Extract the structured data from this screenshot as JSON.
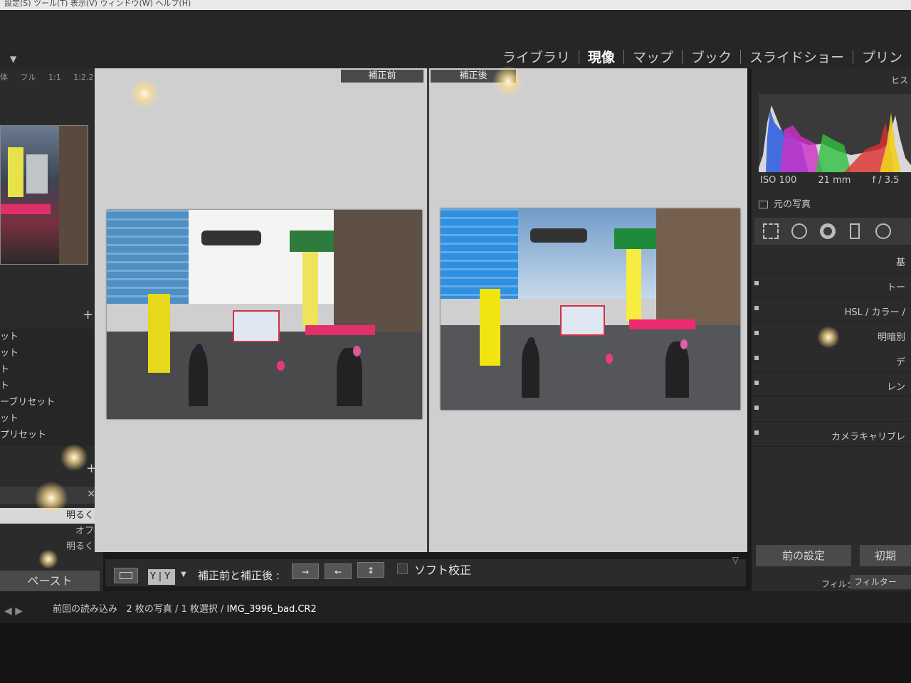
{
  "menubar": {
    "text": "設定(S)  ツール(T)  表示(V)  ウィンドウ(W)  ヘルプ(H)"
  },
  "top": {
    "modules": [
      "ライブラリ",
      "現像",
      "マップ",
      "ブック",
      "スライドショー",
      "プリン"
    ],
    "active_module": "現像"
  },
  "navigator": {
    "label": "体",
    "zoom_options": [
      "フル",
      "1:1",
      "1:2.2 ÷"
    ]
  },
  "presets": {
    "items": [
      "ット",
      "ット",
      "ト",
      "ト",
      "ーブリセット",
      "ット",
      "プリセット"
    ]
  },
  "snapshots": {
    "close": "×",
    "items": [
      "明るく",
      "オフ",
      "明るく"
    ],
    "selected_index": 0
  },
  "left_buttons": {
    "paste": "ペースト"
  },
  "compare": {
    "before_label": "補正前",
    "after_label": "補正後"
  },
  "toolbar": {
    "yy_label": "Y|Y",
    "label": "補正前と補正後 :",
    "swap_buttons": [
      "→",
      "←",
      "↕"
    ],
    "soft_proof": "ソフト校正"
  },
  "histogram": {
    "title": "ヒス",
    "iso": "ISO 100",
    "focal": "21 mm",
    "aperture": "f / 3.5",
    "original_photo": "元の写真"
  },
  "develop_sections": [
    "基",
    "トー",
    "HSL / カラー /",
    "明暗別",
    "デ",
    "レン",
    "",
    "カメラキャリブレ"
  ],
  "right_buttons": {
    "previous": "前の設定",
    "reset": "初期"
  },
  "filter": {
    "label": "フィルター :",
    "value": "フィルター"
  },
  "filmstrip": {
    "source": "前回の読み込み",
    "count": "2 枚の写真 / 1 枚選択 /",
    "filename": "IMG_3996_bad.CR2"
  },
  "colors": {
    "panel": "#2b2b2b",
    "background": "#1a1a1a",
    "compare_bg": "#cfcfcf"
  }
}
